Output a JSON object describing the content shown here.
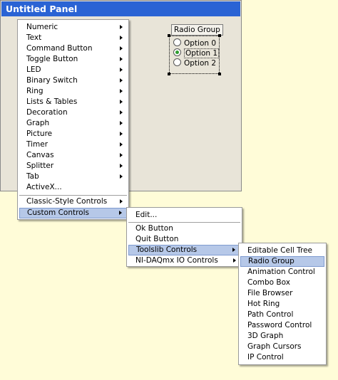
{
  "panel": {
    "title": "Untitled Panel",
    "radio_group": {
      "label": "Radio Group",
      "options": [
        "Option 0",
        "Option 1",
        "Option 2"
      ],
      "selected": "Option 1"
    }
  },
  "menu_main": {
    "items": [
      "Numeric",
      "Text",
      "Command Button",
      "Toggle Button",
      "LED",
      "Binary Switch",
      "Ring",
      "Lists & Tables",
      "Decoration",
      "Graph",
      "Picture",
      "Timer",
      "Canvas",
      "Splitter",
      "Tab",
      "ActiveX..."
    ],
    "classic": "Classic-Style Controls",
    "custom": "Custom Controls"
  },
  "menu_custom": {
    "edit": "Edit...",
    "items": [
      "Ok Button",
      "Quit Button",
      "Toolslib Controls",
      "NI-DAQmx IO Controls"
    ]
  },
  "menu_toolslib": {
    "items": [
      "Editable Cell Tree",
      "Radio Group",
      "Animation Control",
      "Combo Box",
      "File Browser",
      "Hot Ring",
      "Path Control",
      "Password Control",
      "3D Graph",
      "Graph Cursors",
      "IP Control"
    ],
    "highlighted": "Radio Group"
  },
  "colors": {
    "titlebar": "#2a63d4",
    "highlight": "#b6c8e8",
    "workspace": "#fffcd8",
    "radio_selected": "#2e9d2e"
  }
}
